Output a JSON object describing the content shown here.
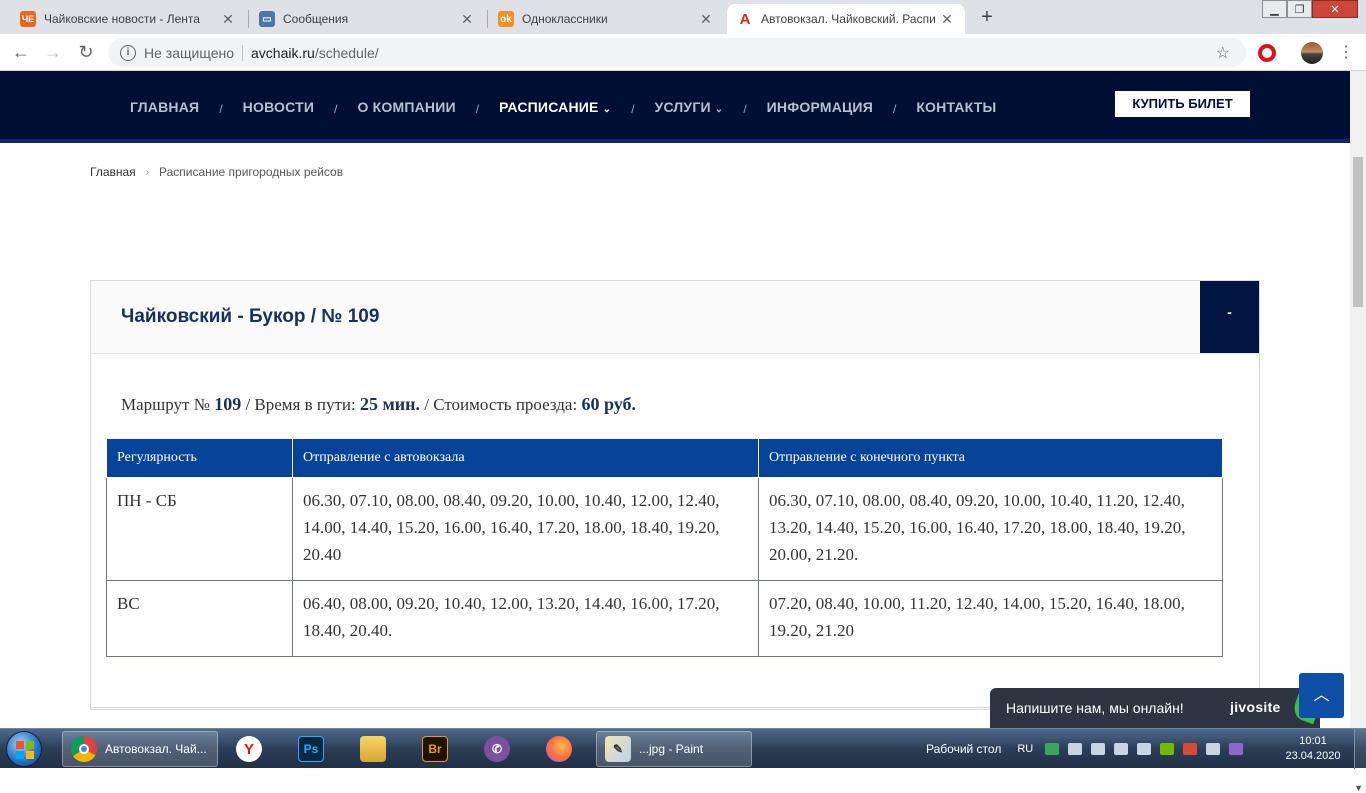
{
  "browser": {
    "tabs": [
      {
        "label": "Чайковские новости - Лента",
        "favicon": "ЧЕ",
        "color": "#e86a1e",
        "active": false
      },
      {
        "label": "Сообщения",
        "favicon": "vk-icon",
        "color": "#4a76a8",
        "active": false
      },
      {
        "label": "Одноклассники",
        "favicon": "ok-icon",
        "color": "#f29025",
        "active": false
      },
      {
        "label": "Автовокзал. Чайковский. Распи",
        "favicon": "A",
        "color": "#d9251c",
        "active": true
      }
    ],
    "address": {
      "security": "Не защищено",
      "host": "avchaik.ru",
      "path": "/schedule/"
    }
  },
  "site": {
    "menu": [
      {
        "label": "ГЛАВНАЯ",
        "active": false,
        "dropdown": false
      },
      {
        "label": "НОВОСТИ",
        "active": false,
        "dropdown": false
      },
      {
        "label": "О КОМПАНИИ",
        "active": false,
        "dropdown": false
      },
      {
        "label": "РАСПИСАНИЕ",
        "active": true,
        "dropdown": true
      },
      {
        "label": "УСЛУГИ",
        "active": false,
        "dropdown": true
      },
      {
        "label": "ИНФОРМАЦИЯ",
        "active": false,
        "dropdown": false
      },
      {
        "label": "КОНТАКТЫ",
        "active": false,
        "dropdown": false
      }
    ],
    "menu_separator": "/",
    "buy_button": "КУПИТЬ БИЛЕТ",
    "breadcrumb": {
      "home": "Главная",
      "current": "Расписание пригородных рейсов"
    },
    "route": {
      "title": "Чайковский - Букор / № 109",
      "toggle": "-",
      "summary": {
        "route_label": "Маршрут №",
        "route_number": "109",
        "time_label": "/ Время в пути:",
        "time_value": "25 мин.",
        "price_label": "/ Стоимость проезда:",
        "price_value": "60 руб."
      },
      "table": {
        "headers": [
          "Регулярность",
          "Отправление с автовокзала",
          "Отправление с конечного пункта"
        ],
        "rows": [
          {
            "days": "ПН - СБ",
            "from_station": "06.30, 07.10, 08.00, 08.40, 09.20, 10.00, 10.40, 12.00, 12.40, 14.00, 14.40, 15.20, 16.00, 16.40, 17.20, 18.00, 18.40, 19.20, 20.40",
            "from_terminal": "06.30, 07.10, 08.00, 08.40, 09.20, 10.00, 10.40, 11.20, 12.40, 13.20, 14.40, 15.20, 16.00, 16.40, 17.20, 18.00, 18.40, 19.20, 20.00, 21.20."
          },
          {
            "days": "ВС",
            "from_station": "06.40, 08.00, 09.20, 10.40, 12.00, 13.20, 14.40, 16.00, 17.20, 18.40, 20.40.",
            "from_terminal": "07.20, 08.40, 10.00, 11.20, 12.40, 14.00, 15.20, 16.40, 18.00, 19.20, 21.20"
          }
        ]
      }
    },
    "chat": {
      "text": "Напишите нам, мы онлайн!",
      "brand": "jivosite"
    }
  },
  "taskbar": {
    "items": [
      {
        "name": "chrome",
        "label": "Автовокзал. Чай...",
        "active": true
      },
      {
        "name": "yandex",
        "label": "Y"
      },
      {
        "name": "photoshop",
        "label": "Ps"
      },
      {
        "name": "explorer",
        "label": ""
      },
      {
        "name": "bridge",
        "label": "Br"
      },
      {
        "name": "viber",
        "label": ""
      },
      {
        "name": "firefox",
        "label": ""
      },
      {
        "name": "paint",
        "label": "...jpg - Paint",
        "active": true
      }
    ],
    "desktop_label": "Рабочий стол",
    "language": "RU",
    "time": "10:01",
    "date": "23.04.2020"
  }
}
